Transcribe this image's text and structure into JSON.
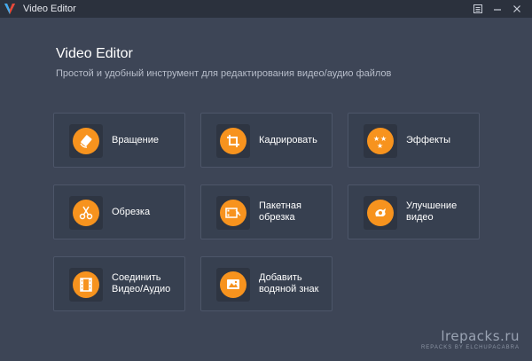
{
  "window": {
    "title": "Video Editor",
    "controls": {
      "menu": "≡",
      "minimize": "—",
      "close": "✕"
    }
  },
  "header": {
    "title": "Video Editor",
    "subtitle": "Простой и удобный инструмент для редактирования видео/аудио файлов"
  },
  "tools": [
    {
      "label": "Вращение",
      "icon": "rotate-icon"
    },
    {
      "label": "Кадрировать",
      "icon": "crop-icon"
    },
    {
      "label": "Эффекты",
      "icon": "effects-icon"
    },
    {
      "label": "Обрезка",
      "icon": "scissors-icon"
    },
    {
      "label": "Пакетная\nобрезка",
      "icon": "batch-trim-icon"
    },
    {
      "label": "Улучшение\nвидео",
      "icon": "enhance-icon"
    },
    {
      "label": "Соединить\nВидео/Аудио",
      "icon": "merge-icon"
    },
    {
      "label": "Добавить\nводяной знак",
      "icon": "watermark-icon"
    }
  ],
  "watermark": {
    "main": "lrepacks.ru",
    "sub": "REPACKS BY ELCHUPACABRA"
  },
  "colors": {
    "background": "#3d4556",
    "card": "#374050",
    "accent": "#f7931e",
    "titlebar": "#2b313d"
  }
}
